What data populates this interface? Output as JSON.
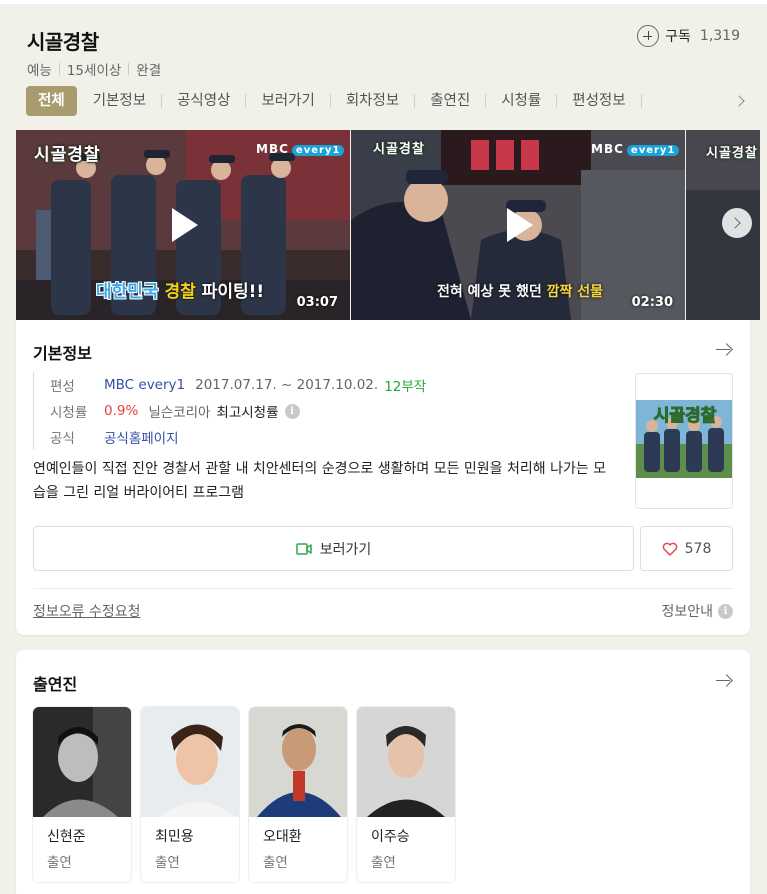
{
  "header": {
    "title": "시골경찰",
    "subscribe_label": "구독",
    "subscribe_count": "1,319",
    "meta": [
      "예능",
      "15세이상",
      "완결"
    ]
  },
  "tabs": [
    "전체",
    "기본정보",
    "공식영상",
    "보러가기",
    "회차정보",
    "출연진",
    "시청률",
    "편성정보"
  ],
  "videos": [
    {
      "duration": "03:07",
      "logo": "시골경찰",
      "caption_a": "대한민국",
      "caption_b": "경찰",
      "caption_c": "파이팅!!",
      "broadcaster": "MBC",
      "channel": "every1"
    },
    {
      "duration": "02:30",
      "logo": "시골경찰",
      "caption_a": "전혀 예상 못 했던",
      "caption_b": "깜짝 선물",
      "broadcaster": "MBC",
      "channel": "every1"
    },
    {
      "logo": "시골경찰"
    }
  ],
  "basic_info": {
    "title": "기본정보",
    "schedule_label": "편성",
    "channel": "MBC every1",
    "period": "2017.07.17. ~ 2017.10.02.",
    "episodes": "12부작",
    "rating_label": "시청률",
    "rating_value": "0.9%",
    "rating_source": "닐슨코리아",
    "rating_note": "최고시청률",
    "official_label": "공식",
    "official_link": "공식홈페이지",
    "description": "연예인들이 직접 진안 경찰서 관할 내 치안센터의 순경으로 생활하며 모든 민원을 처리해 나가는 모습을 그린 리얼 버라이어티 프로그램",
    "poster_text": "시골경찰",
    "watch_label": "보러가기",
    "like_count": "578",
    "report_label": "정보오류 수정요청",
    "guide_label": "정보안내"
  },
  "cast": {
    "title": "출연진",
    "members": [
      {
        "name": "신현준",
        "role": "출연"
      },
      {
        "name": "최민용",
        "role": "출연"
      },
      {
        "name": "오대환",
        "role": "출연"
      },
      {
        "name": "이주승",
        "role": "출연"
      }
    ]
  },
  "colors": {
    "accent": "#a89c6e",
    "link": "#3451a8",
    "green": "#29a63c",
    "red": "#e43f3f"
  }
}
